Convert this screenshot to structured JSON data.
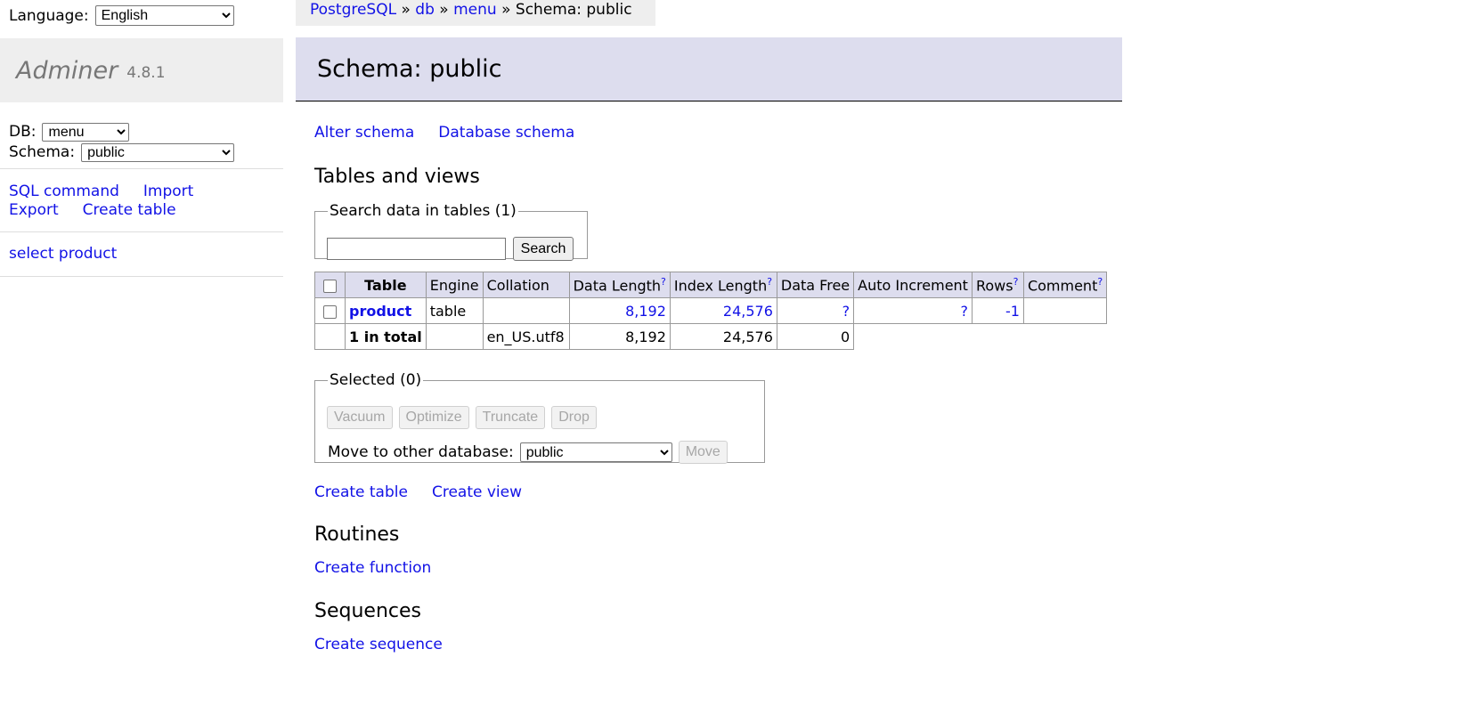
{
  "sidebar": {
    "language_label": "Language:",
    "language_value": "English",
    "brand_name": "Adminer",
    "brand_version": "4.8.1",
    "db_label": "DB:",
    "db_value": "menu",
    "schema_label": "Schema:",
    "schema_value": "public",
    "links": [
      "SQL command",
      "Import",
      "Export",
      "Create table"
    ],
    "table_link": "select product"
  },
  "breadcrumb": {
    "items": [
      "PostgreSQL",
      "db",
      "menu"
    ],
    "separator": "»",
    "current": "Schema: public"
  },
  "header": {
    "title": "Schema: public"
  },
  "main": {
    "top_links": [
      "Alter schema",
      "Database schema"
    ],
    "tables_heading": "Tables and views",
    "search": {
      "legend": "Search data in tables (1)",
      "input_value": "",
      "button_label": "Search"
    },
    "table": {
      "columns": [
        "Table",
        "Engine",
        "Collation",
        "Data Length",
        "Index Length",
        "Data Free",
        "Auto Increment",
        "Rows",
        "Comment"
      ],
      "help_mark": "?",
      "rows": [
        {
          "name": "product",
          "engine": "table",
          "collation": "",
          "data_length": "8,192",
          "index_length": "24,576",
          "data_free": "?",
          "auto_increment": "?",
          "rows": "-1",
          "comment": ""
        }
      ],
      "total": {
        "label": "1 in total",
        "engine": "",
        "collation": "en_US.utf8",
        "data_length": "8,192",
        "index_length": "24,576",
        "data_free": "0"
      }
    },
    "selected": {
      "legend": "Selected (0)",
      "buttons": [
        "Vacuum",
        "Optimize",
        "Truncate",
        "Drop"
      ],
      "move_label": "Move to other database:",
      "move_value": "public",
      "move_button": "Move"
    },
    "bottom_links": [
      "Create table",
      "Create view"
    ],
    "routines_heading": "Routines",
    "create_function": "Create function",
    "sequences_heading": "Sequences",
    "create_sequence": "Create sequence"
  },
  "colors": {
    "link": "#1212e6",
    "header_bg": "#dde",
    "sidebar_bg": "#eee"
  }
}
